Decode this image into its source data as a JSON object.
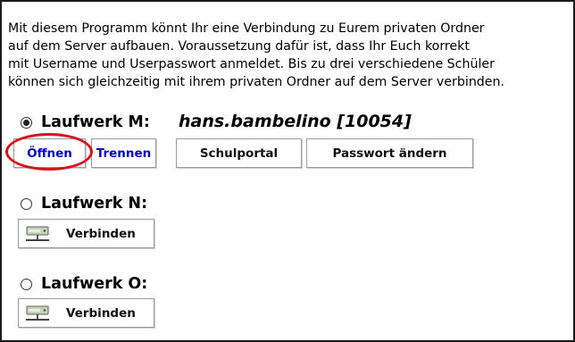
{
  "intro": {
    "lines": [
      "Mit diesem Programm könnt Ihr eine Verbindung zu Eurem privaten Ordner",
      "auf dem Server aufbauen. Voraussetzung dafür ist, dass Ihr Euch korrekt",
      "mit Username und Userpasswort anmeldet. Bis zu drei verschiedene Schüler",
      "können sich gleichzeitig mit ihrem privaten Ordner auf dem Server verbinden."
    ]
  },
  "drives": [
    {
      "label": "Laufwerk M:",
      "selected": true,
      "user": "hans.bambelino [10054]",
      "buttons": {
        "open": "Öffnen",
        "disconnect": "Trennen",
        "portal": "Schulportal",
        "password": "Passwort ändern"
      }
    },
    {
      "label": "Laufwerk N:",
      "selected": false,
      "connect": "Verbinden",
      "icon": "network-drive-icon"
    },
    {
      "label": "Laufwerk O:",
      "selected": false,
      "connect": "Verbinden",
      "icon": "network-drive-icon"
    }
  ],
  "colors": {
    "link_button": "#0000cc",
    "highlight_circle": "#d9101e"
  }
}
